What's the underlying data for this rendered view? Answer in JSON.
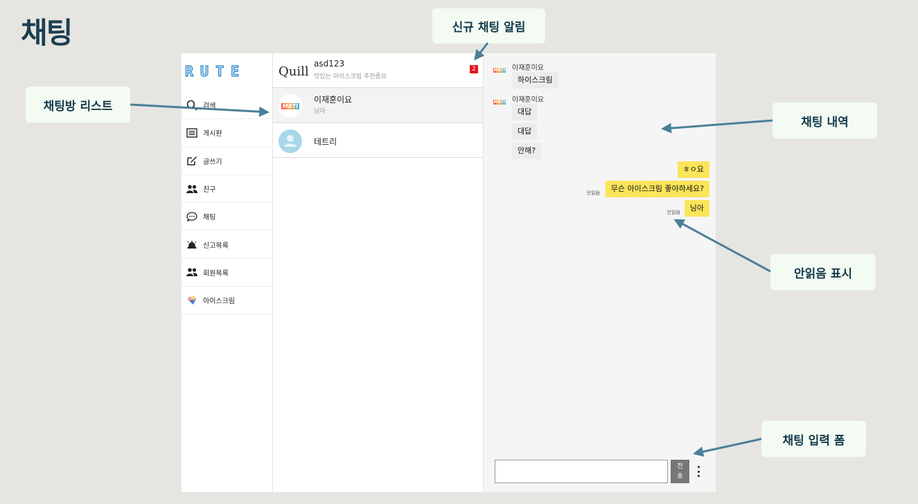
{
  "page": {
    "title": "채팅"
  },
  "callouts": {
    "new_chat_alert": "신규 채팅 알림",
    "room_list": "채팅방 리스트",
    "chat_history": "채팅 내역",
    "unread_display": "안읽음 표시",
    "chat_input_form": "채팅 입력 폼"
  },
  "app": {
    "logo": "RUTE",
    "nav": [
      {
        "label": "검색",
        "icon": "search-icon"
      },
      {
        "label": "게시판",
        "icon": "board-icon"
      },
      {
        "label": "글쓰기",
        "icon": "write-icon"
      },
      {
        "label": "친구",
        "icon": "friends-icon"
      },
      {
        "label": "채팅",
        "icon": "chat-icon"
      },
      {
        "label": "신고목록",
        "icon": "report-bell-icon"
      },
      {
        "label": "회원목록",
        "icon": "members-icon"
      },
      {
        "label": "아이스크림",
        "icon": "ice-cream-icon"
      }
    ],
    "rooms": [
      {
        "name": "asd123",
        "preview": "맛있는 아이스크림 추천좀요",
        "badge": "2",
        "avatar": "Quill"
      },
      {
        "name": "이재훈이요",
        "preview": "님아",
        "avatar": "MBTI"
      },
      {
        "name": "테트리",
        "avatar": "default-user"
      }
    ],
    "chat": {
      "messages": [
        {
          "sender": "이재훈이요",
          "text": "하이스크림",
          "direction": "in"
        },
        {
          "sender": "이재훈이요",
          "text": "대답",
          "direction": "in"
        },
        {
          "text": "대답",
          "direction": "in"
        },
        {
          "text": "안해?",
          "direction": "in"
        },
        {
          "text": "ㅎㅇ요",
          "direction": "out"
        },
        {
          "text": "무슨 아이스크림 좋아하세요?",
          "direction": "out",
          "status": "안읽음"
        },
        {
          "text": "님아",
          "direction": "out",
          "status": "안읽음"
        }
      ],
      "input": {
        "value": "",
        "placeholder": ""
      },
      "send_label_1": "전",
      "send_label_2": "송"
    }
  },
  "colors": {
    "accent_dark": "#1c3f50",
    "arrow": "#4a7f99",
    "badge": "#e8121b",
    "my_bubble": "#fbe55a",
    "their_bubble": "#ececec"
  }
}
